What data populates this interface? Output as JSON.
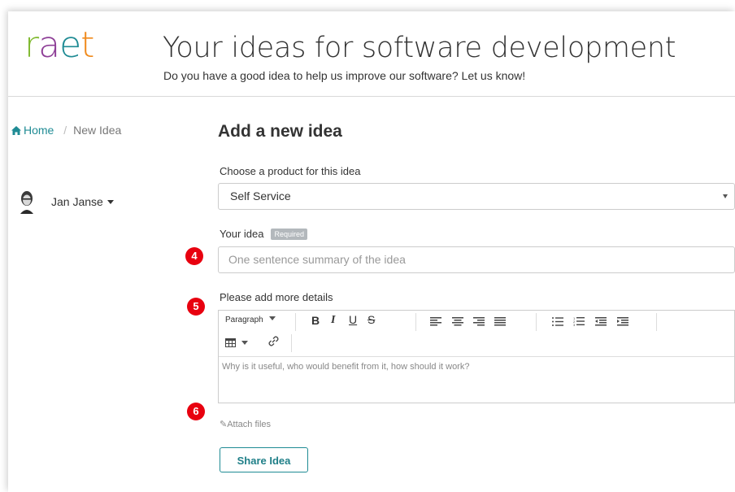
{
  "brand": {
    "logo_letters": [
      {
        "ch": "r",
        "color": "#7fb92e"
      },
      {
        "ch": "a",
        "color": "#8e3f97"
      },
      {
        "ch": "e",
        "color": "#1f8b94"
      },
      {
        "ch": "t",
        "color": "#f08a1c"
      }
    ]
  },
  "header": {
    "title": "Your ideas for software development",
    "subtitle": "Do you have a good idea to help us improve our software? Let us know!"
  },
  "breadcrumb": {
    "home": "Home",
    "current": "New Idea",
    "separator": "/"
  },
  "user": {
    "name": "Jan Janse"
  },
  "form": {
    "title": "Add a new idea",
    "product_label": "Choose a product for this idea",
    "product_value": "Self Service",
    "idea_label": "Your idea",
    "required_badge": "Required",
    "idea_placeholder": "One sentence summary of the idea",
    "details_label": "Please add more details",
    "toolbar": {
      "paragraph": "Paragraph"
    },
    "details_placeholder": "Why is it useful, who would benefit from it, how should it work?",
    "attach_label": "Attach files",
    "submit_label": "Share Idea"
  },
  "annotations": [
    "4",
    "5",
    "6"
  ],
  "colors": {
    "accent": "#1f8b94",
    "badge": "#e8000f"
  }
}
